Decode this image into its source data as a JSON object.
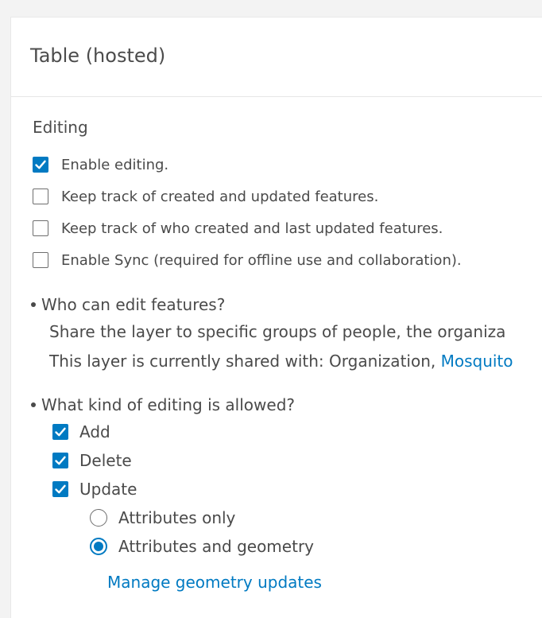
{
  "panel": {
    "title": "Table (hosted)"
  },
  "editing": {
    "heading": "Editing",
    "options": [
      {
        "label": "Enable editing.",
        "checked": true
      },
      {
        "label": "Keep track of created and updated features.",
        "checked": false
      },
      {
        "label": "Keep track of who created and last updated features.",
        "checked": false
      },
      {
        "label": "Enable Sync (required for offline use and collaboration).",
        "checked": false
      }
    ]
  },
  "who_can_edit": {
    "heading": "Who can edit features?",
    "description": "Share the layer to specific groups of people, the organiza",
    "shared_prefix": "This layer is currently shared with: Organization, ",
    "shared_link": "Mosquito"
  },
  "editing_allowed": {
    "heading": "What kind of editing is allowed?",
    "operations": [
      {
        "label": "Add",
        "checked": true
      },
      {
        "label": "Delete",
        "checked": true
      },
      {
        "label": "Update",
        "checked": true
      }
    ],
    "update_modes": [
      {
        "label": "Attributes only",
        "selected": false
      },
      {
        "label": "Attributes and geometry",
        "selected": true
      }
    ],
    "manage_link": "Manage geometry updates"
  },
  "colors": {
    "accent": "#007ac2",
    "text": "#4a4a4a"
  }
}
